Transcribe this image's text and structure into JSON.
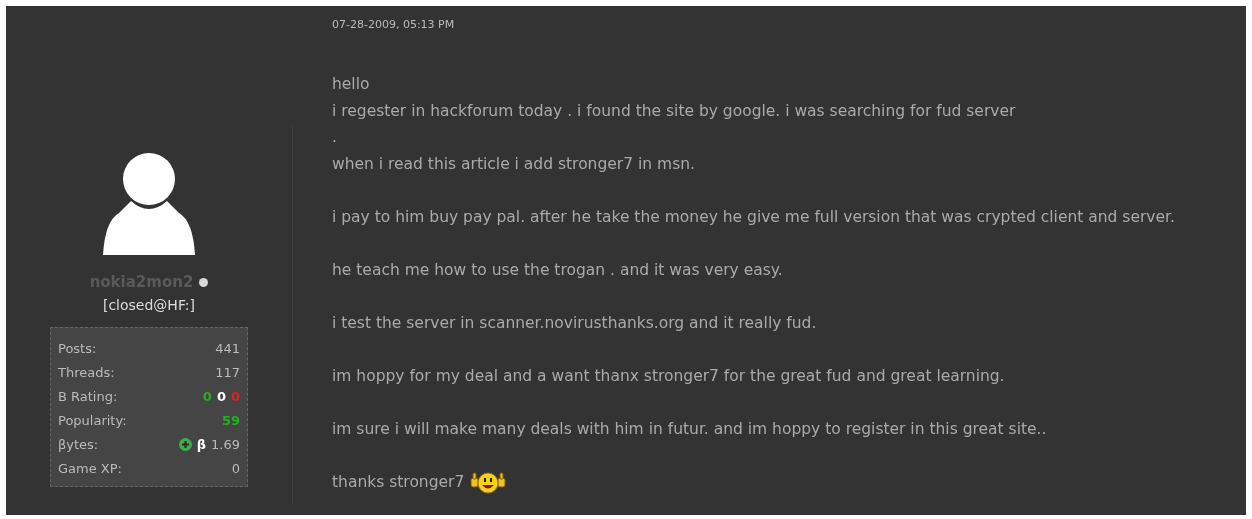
{
  "post": {
    "date": "07-28-2009, 05:13 PM",
    "author": {
      "username": "nokia2mon2",
      "title": "[closed@HF:]",
      "stats": [
        {
          "kind": "plain",
          "label": "Posts:",
          "value": "441"
        },
        {
          "kind": "plain",
          "label": "Threads:",
          "value": "117"
        },
        {
          "kind": "rating",
          "label": "B Rating:",
          "parts": [
            {
              "text": "0",
              "color": "#1fb31f"
            },
            {
              "text": "0",
              "color": "#ffffff"
            },
            {
              "text": "0",
              "color": "#e52020"
            }
          ]
        },
        {
          "kind": "popularity",
          "label": "Popularity:",
          "value": "59"
        },
        {
          "kind": "bytes",
          "label": "βytes:",
          "symbol": "β",
          "value": "1.69"
        },
        {
          "kind": "plain",
          "label": "Game XP:",
          "value": "0"
        }
      ]
    },
    "paragraphs": [
      {
        "lines": [
          "hello",
          "i regester in hackforum today . i found the site by google. i was searching for fud server",
          ".",
          "when i read this article i add stronger7 in msn."
        ]
      },
      {
        "lines": [
          "i pay to him buy pay pal. after he take the money he give me full version that was crypted client and server."
        ]
      },
      {
        "lines": [
          "he teach me how to use the trogan . and it was very easy."
        ]
      },
      {
        "lines": [
          "i test the server in scanner.novirusthanks.org and it really fud."
        ]
      },
      {
        "lines": [
          "im hoppy for my deal and a want thanx stronger7 for the great fud and great learning."
        ]
      },
      {
        "lines": [
          "im sure i will make many deals with him in futur. and im hoppy to register in this great site.."
        ]
      },
      {
        "lines": [
          "thanks stronger7"
        ],
        "emoticon": true
      }
    ]
  }
}
